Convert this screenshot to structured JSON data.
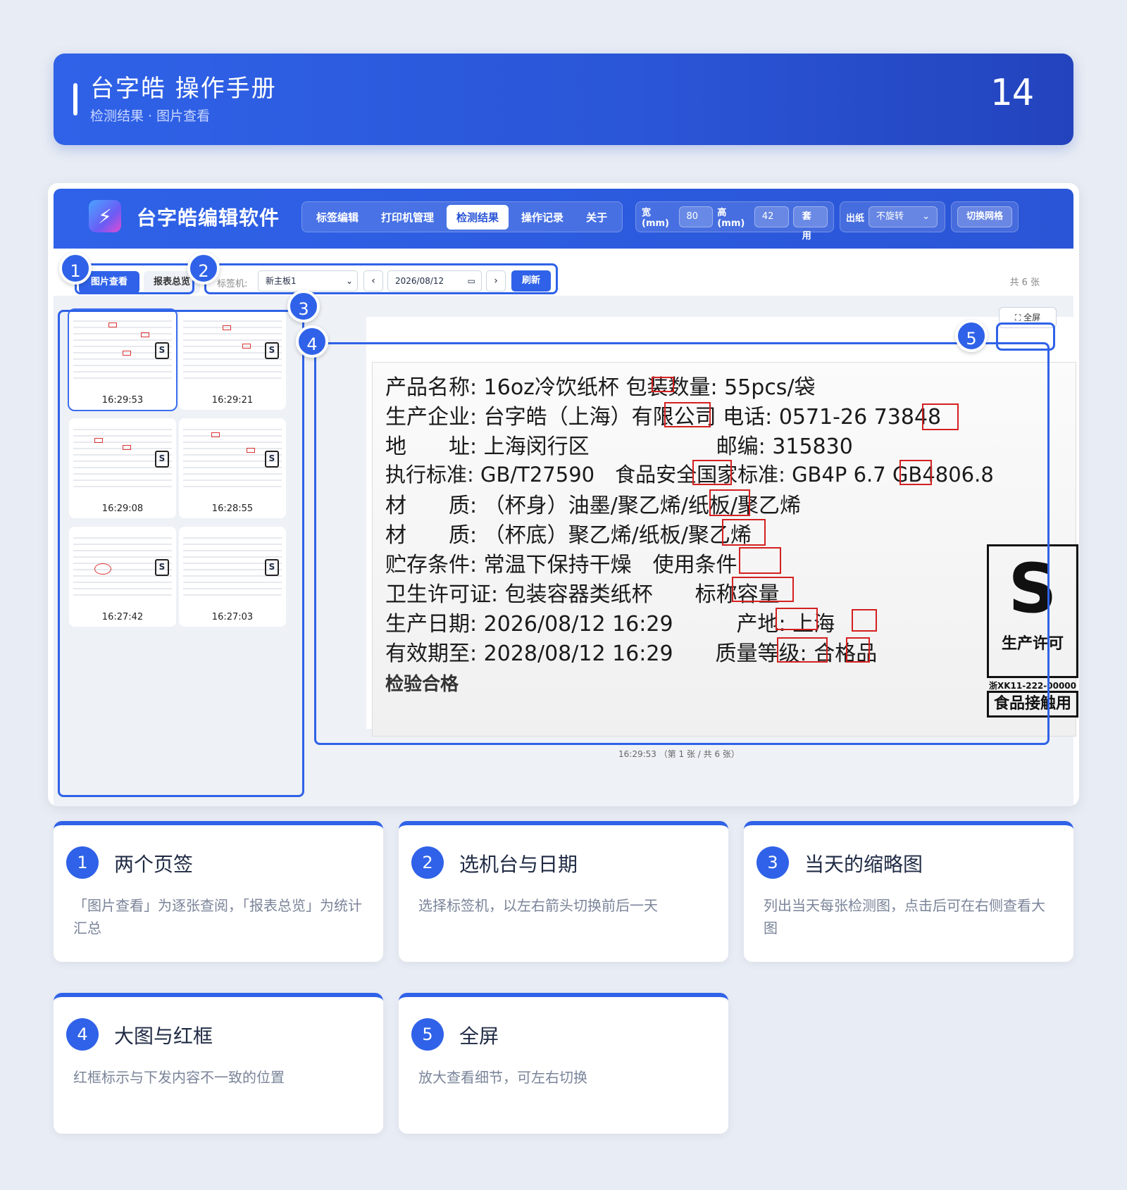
{
  "header": {
    "title": "台字皓 操作手册",
    "subtitle": "检测结果 · 图片查看",
    "page_number": "14"
  },
  "app": {
    "title": "台字皓编辑软件",
    "logo_icon": "lightning-icon",
    "nav": [
      "标签编辑",
      "打印机管理",
      "检测结果",
      "操作记录",
      "关于"
    ],
    "active_nav": "检测结果",
    "size_controls": {
      "width_label": "宽(mm)",
      "width_value": "80",
      "height_label": "高(mm)",
      "height_value": "42",
      "apply_label": "套用"
    },
    "paper": {
      "label": "出纸",
      "value": "不旋转"
    },
    "grid_toggle_label": "切换网格"
  },
  "toolbar": {
    "tab_view": "图片查看",
    "tab_report": "报表总览",
    "printer_label": "标签机:",
    "printer_value": "新主板1",
    "prev": "‹",
    "date_value": "2026/08/12",
    "next": "›",
    "refresh_label": "刷新",
    "count_text": "共 6 张"
  },
  "thumbnails": [
    {
      "time": "16:29:53",
      "selected": true
    },
    {
      "time": "16:29:21",
      "selected": false
    },
    {
      "time": "16:29:08",
      "selected": false
    },
    {
      "time": "16:28:55",
      "selected": false
    },
    {
      "time": "16:27:42",
      "selected": false
    },
    {
      "time": "16:27:03",
      "selected": false
    }
  ],
  "viewer": {
    "fullscreen_label": "⛶ 全屏",
    "caption": "16:29:53 （第 1 张 / 共 6 张）",
    "label_lines": [
      "产品名称: 16oz冷饮纸杯 包装数量: 55pcs/袋",
      "生产企业: 台字皓（上海）有限公司 电话: 0571-26  73848",
      "地　　址: 上海闵行区　　　　　　邮编: 315830",
      "执行标准: GB/T27590　食品安全国家标准: GB4P  6.7 GB4806.8",
      "材　　质: （杯身）油墨/聚乙烯/纸板/聚乙烯",
      "材　　质: （杯底）聚乙烯/纸板/聚乙烯",
      "贮存条件: 常温下保持干燥　使用条件",
      "卫生许可证: 包装容器类纸杯　　标称容量",
      "生产日期: 2026/08/12 16:29　　　产地: 上海",
      "有效期至: 2028/08/12 16:29　　质量等级: 合格品"
    ],
    "label_footer": "检验合格",
    "qs_mark": "S",
    "qs_text": "生产许可",
    "qs_license": "浙XK11-222-00000",
    "qs_use": "食品接触用"
  },
  "annotations": [
    "1",
    "2",
    "3",
    "4",
    "5"
  ],
  "cards": [
    {
      "num": "1",
      "title": "两个页签",
      "desc": "「图片查看」为逐张查阅，「报表总览」为统计汇总"
    },
    {
      "num": "2",
      "title": "选机台与日期",
      "desc": "选择标签机，以左右箭头切换前后一天"
    },
    {
      "num": "3",
      "title": "当天的缩略图",
      "desc": "列出当天每张检测图，点击后可在右侧查看大图"
    },
    {
      "num": "4",
      "title": "大图与红框",
      "desc": "红框标示与下发内容不一致的位置"
    },
    {
      "num": "5",
      "title": "全屏",
      "desc": "放大查看细节，可左右切换"
    }
  ],
  "colors": {
    "accent": "#2f62e8",
    "error_box": "#d42020",
    "background": "#e8ecf4"
  }
}
